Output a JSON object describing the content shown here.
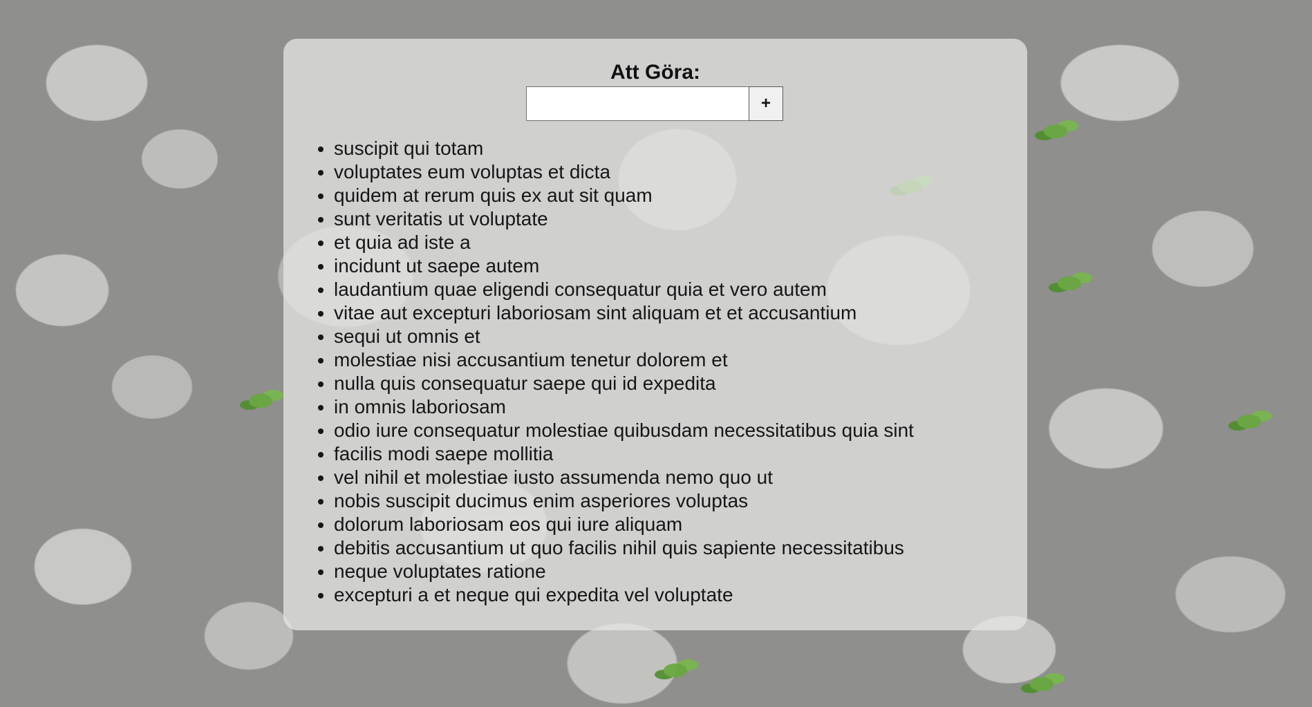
{
  "app": {
    "title": "Att Göra:",
    "input": {
      "value": "",
      "placeholder": ""
    },
    "add_button_label": "+"
  },
  "todos": [
    "suscipit qui totam",
    "voluptates eum voluptas et dicta",
    "quidem at rerum quis ex aut sit quam",
    "sunt veritatis ut voluptate",
    "et quia ad iste a",
    "incidunt ut saepe autem",
    "laudantium quae eligendi consequatur quia et vero autem",
    "vitae aut excepturi laboriosam sint aliquam et et accusantium",
    "sequi ut omnis et",
    "molestiae nisi accusantium tenetur dolorem et",
    "nulla quis consequatur saepe qui id expedita",
    "in omnis laboriosam",
    "odio iure consequatur molestiae quibusdam necessitatibus quia sint",
    "facilis modi saepe mollitia",
    "vel nihil et molestiae iusto assumenda nemo quo ut",
    "nobis suscipit ducimus enim asperiores voluptas",
    "dolorum laboriosam eos qui iure aliquam",
    "debitis accusantium ut quo facilis nihil quis sapiente necessitatibus",
    "neque voluptates ratione",
    "excepturi a et neque qui expedita vel voluptate"
  ],
  "background": {
    "theme": "pebbles-with-plants",
    "accent": "#66a93b"
  }
}
